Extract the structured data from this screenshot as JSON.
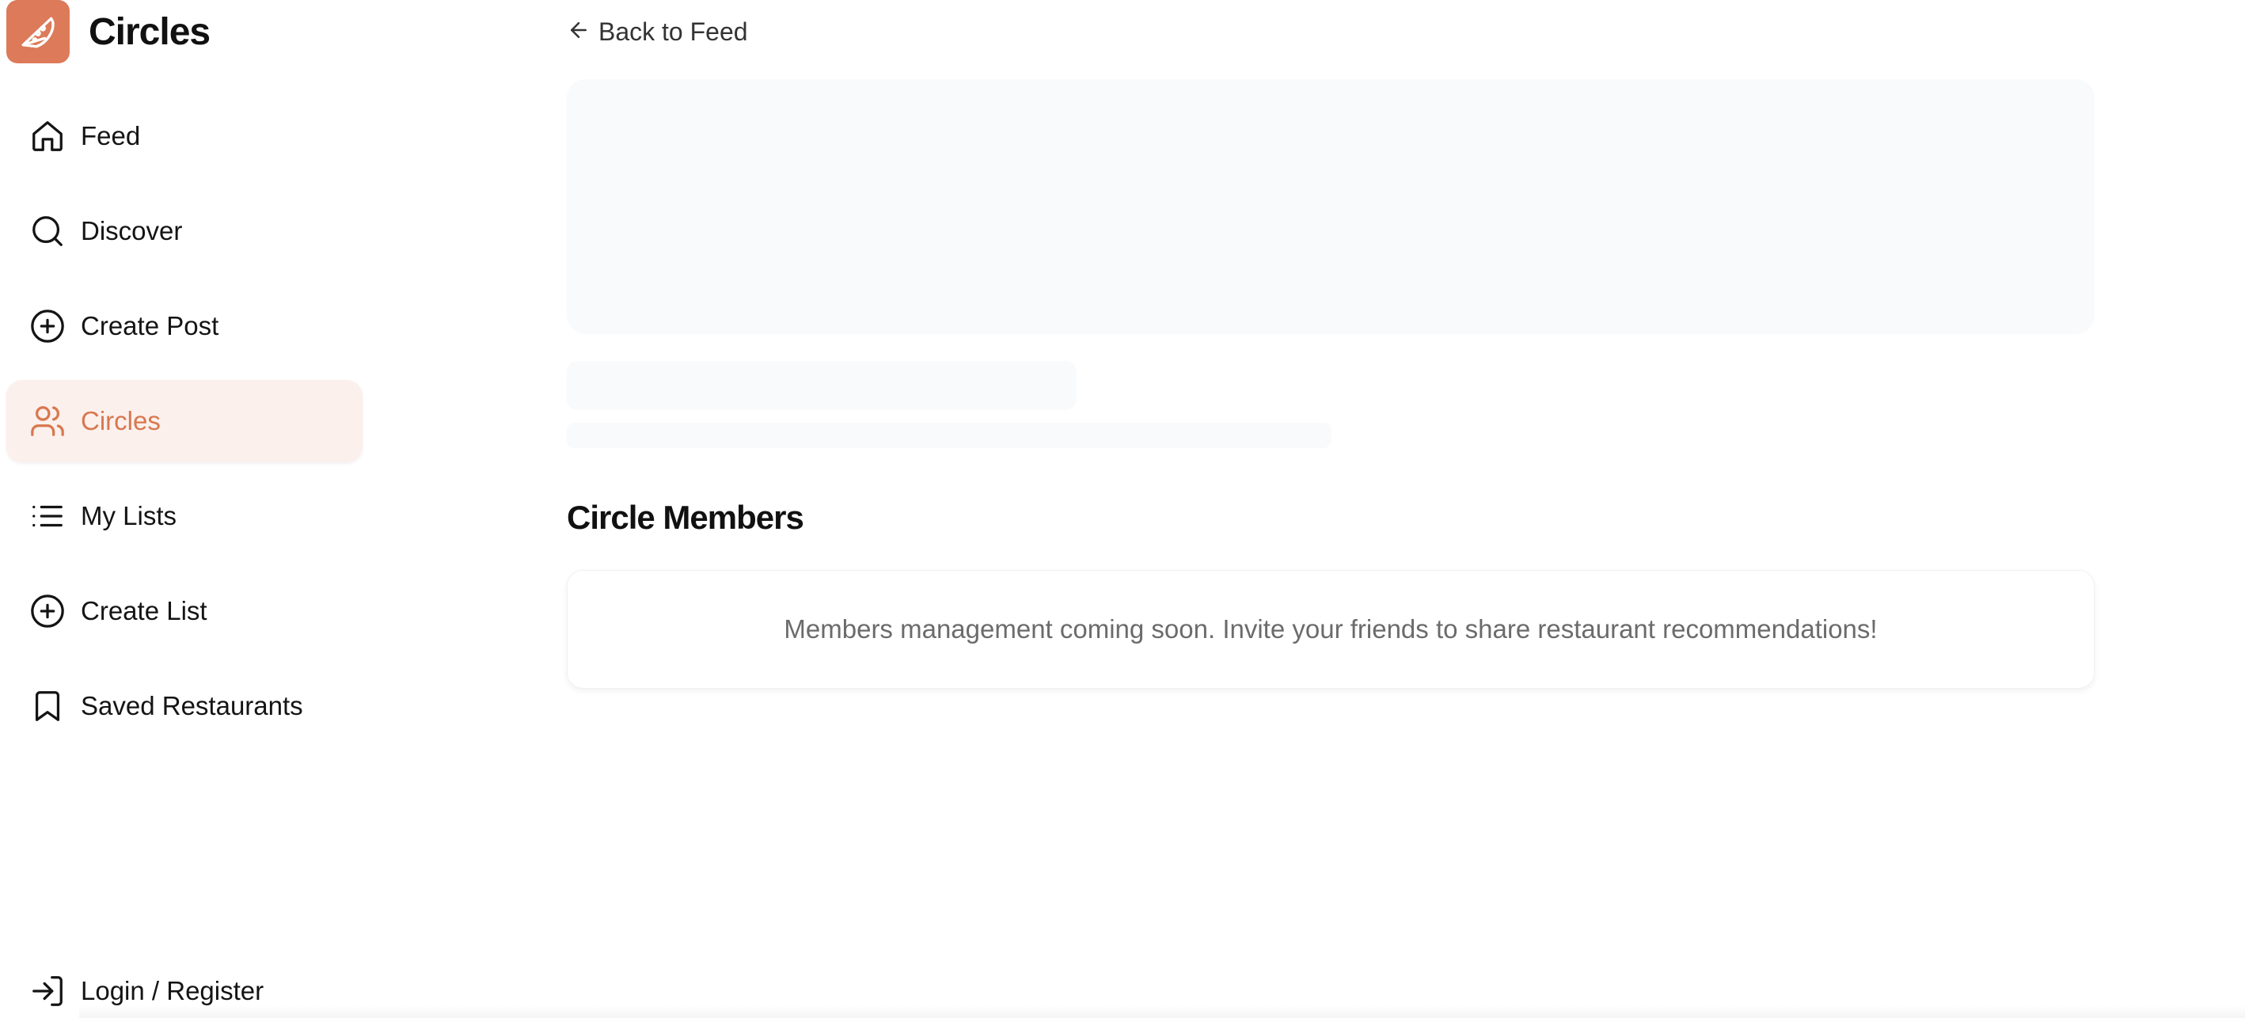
{
  "brand": {
    "title": "Circles",
    "logo_icon": "pizza-icon",
    "accent": "#dc7a5a"
  },
  "sidebar": {
    "items": [
      {
        "label": "Feed",
        "icon": "home-icon"
      },
      {
        "label": "Discover",
        "icon": "search-icon"
      },
      {
        "label": "Create Post",
        "icon": "plus-circle-icon"
      },
      {
        "label": "Circles",
        "icon": "users-icon",
        "active": true
      },
      {
        "label": "My Lists",
        "icon": "list-icon"
      },
      {
        "label": "Create List",
        "icon": "plus-circle-icon"
      },
      {
        "label": "Saved Restaurants",
        "icon": "bookmark-icon"
      }
    ],
    "login_label": "Login / Register",
    "login_icon": "login-icon"
  },
  "main": {
    "back_label": "Back to Feed",
    "members_title": "Circle Members",
    "members_message": "Members management coming soon. Invite your friends to share restaurant recommendations!"
  },
  "colors": {
    "active_bg": "#fbf0ec",
    "active_text": "#d9774f",
    "skeleton": "#f9fafb"
  }
}
